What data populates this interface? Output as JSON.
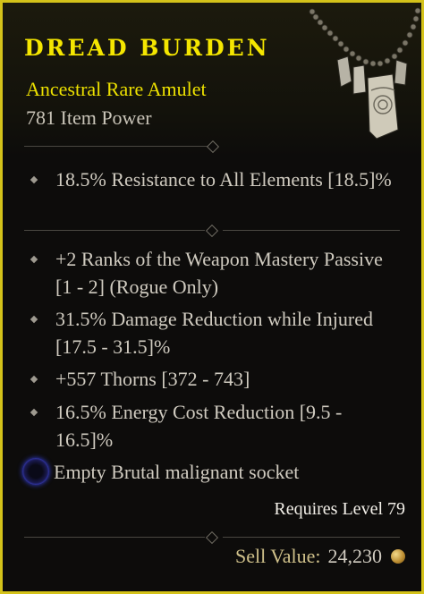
{
  "item": {
    "name": "DREAD BURDEN",
    "type": "Ancestral Rare Amulet",
    "item_power": "781 Item Power"
  },
  "stats": {
    "implicit": [
      {
        "text": "18.5% Resistance to All Elements [18.5]%"
      }
    ],
    "affixes": [
      {
        "text": "+2 Ranks of the Weapon Mastery Passive [1 - 2] (Rogue Only)"
      },
      {
        "text": "31.5% Damage Reduction while Injured [17.5 - 31.5]%"
      },
      {
        "text": "+557 Thorns [372 - 743]"
      },
      {
        "text": "16.5% Energy Cost Reduction [9.5 - 16.5]%"
      }
    ]
  },
  "socket": {
    "text": "Empty Brutal malignant socket",
    "icon": "malignant-socket-icon",
    "color": "#3a3fc8"
  },
  "requirements": {
    "level": "Requires Level 79"
  },
  "sell": {
    "label": "Sell Value:",
    "value": "24,230",
    "icon": "gold-coin-icon"
  },
  "colors": {
    "border": "#d4c21a",
    "title": "#f5e600",
    "rarity": "#ece000",
    "text": "#d0cbc0",
    "background": "#0d0c0b"
  }
}
